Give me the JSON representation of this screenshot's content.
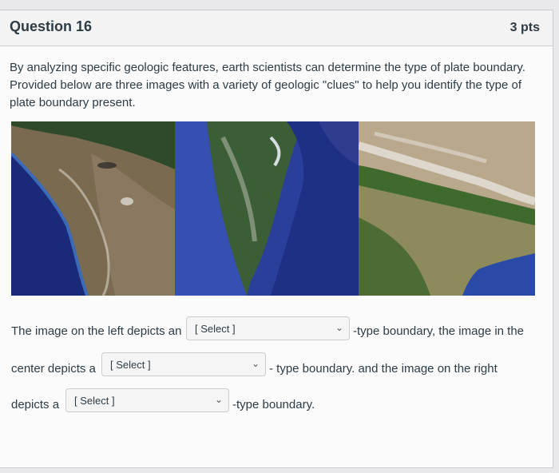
{
  "question": {
    "title": "Question 16",
    "points": "3 pts",
    "prompt": "By analyzing specific geologic features, earth scientists can determine the type of plate boundary. Provided below are three images with a variety of geologic \"clues\" to help you identify the type of plate boundary present."
  },
  "sentence": {
    "part1": "The image on the left depicts an",
    "part2": "-type boundary, the image in the",
    "part3": "center depicts a",
    "part4": "- type boundary. and the image on the right",
    "part5": "depicts a",
    "part6": "-type boundary."
  },
  "selects": {
    "left": "[ Select ]",
    "center": "[ Select ]",
    "right": "[ Select ]"
  },
  "icons": {
    "chevron": "chevron-down-icon"
  }
}
